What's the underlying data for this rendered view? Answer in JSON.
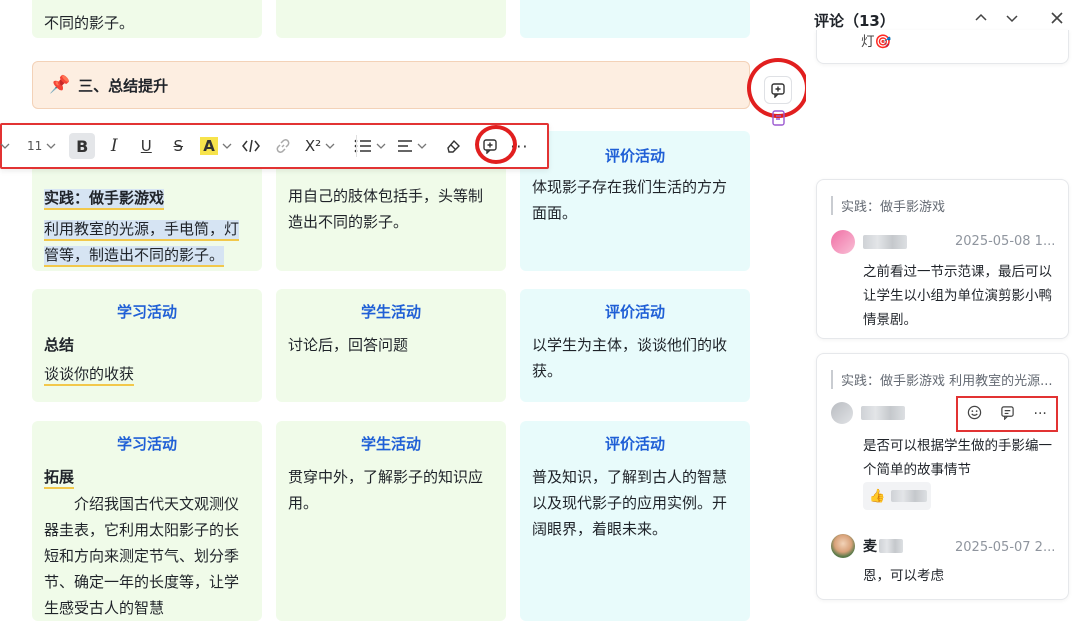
{
  "top_row": {
    "card1_text_tail": "不同的影子。"
  },
  "section_header": {
    "icon": "pushpin-icon",
    "title": "三、总结提升"
  },
  "toolbar": {
    "font_size": "11",
    "bold": "B",
    "italic": "I",
    "underline": "U",
    "strike": "S",
    "highlight": "A",
    "superscript": "X²",
    "more": "···"
  },
  "row1": {
    "col3_title": "评价活动",
    "col1_sub": "实践：做手影游戏",
    "col1_text": "利用教室的光源，手电筒，灯管等，制造出不同的影子。",
    "col2_text": "用自己的肢体包括手，头等制造出不同的影子。",
    "col3_text": "体现影子存在我们生活的方方面面。"
  },
  "row2": {
    "col1_title": "学习活动",
    "col2_title": "学生活动",
    "col3_title": "评价活动",
    "col1_sub": "总结",
    "col1_text": "谈谈你的收获",
    "col2_text": "讨论后，回答问题",
    "col3_text": "以学生为主体，谈谈他们的收获。"
  },
  "row3": {
    "col1_title": "学习活动",
    "col2_title": "学生活动",
    "col3_title": "评价活动",
    "col1_sub": "拓展",
    "col1_text": "介绍我国古代天文观测仪器圭表，它利用太阳影子的长短和方向来测定节气、划分季节、确定一年的长度等，让学生感受古人的智慧",
    "col2_text": "贯穿中外，了解影子的知识应用。",
    "col3_text": "普及知识，了解到古人的智慧以及现代影子的应用实例。开阔眼界，着眼未来。"
  },
  "comments_panel": {
    "title": "评论（13）",
    "partial_top": "灯🎯",
    "c1": {
      "quote": "实践：做手影游戏",
      "date": "2025-05-08 1...",
      "text": "之前看过一节示范课，最后可以让学生以小组为单位演剪影小鸭情景剧。"
    },
    "c2": {
      "quote": "实践：做手影游戏 利用教室的光源...",
      "text": "是否可以根据学生做的手影编一个简单的故事情节",
      "reaction": "👍",
      "reply_name": "麦",
      "reply_date": "2025-05-07 2...",
      "reply_text": "恩，可以考虑"
    }
  },
  "colors": {
    "accent_red": "#e11f1f",
    "title_blue": "#1f5fd6",
    "card_green": "#f0fbe9",
    "card_cyan": "#e8fbfb",
    "header_orange": "#fdeee1"
  }
}
